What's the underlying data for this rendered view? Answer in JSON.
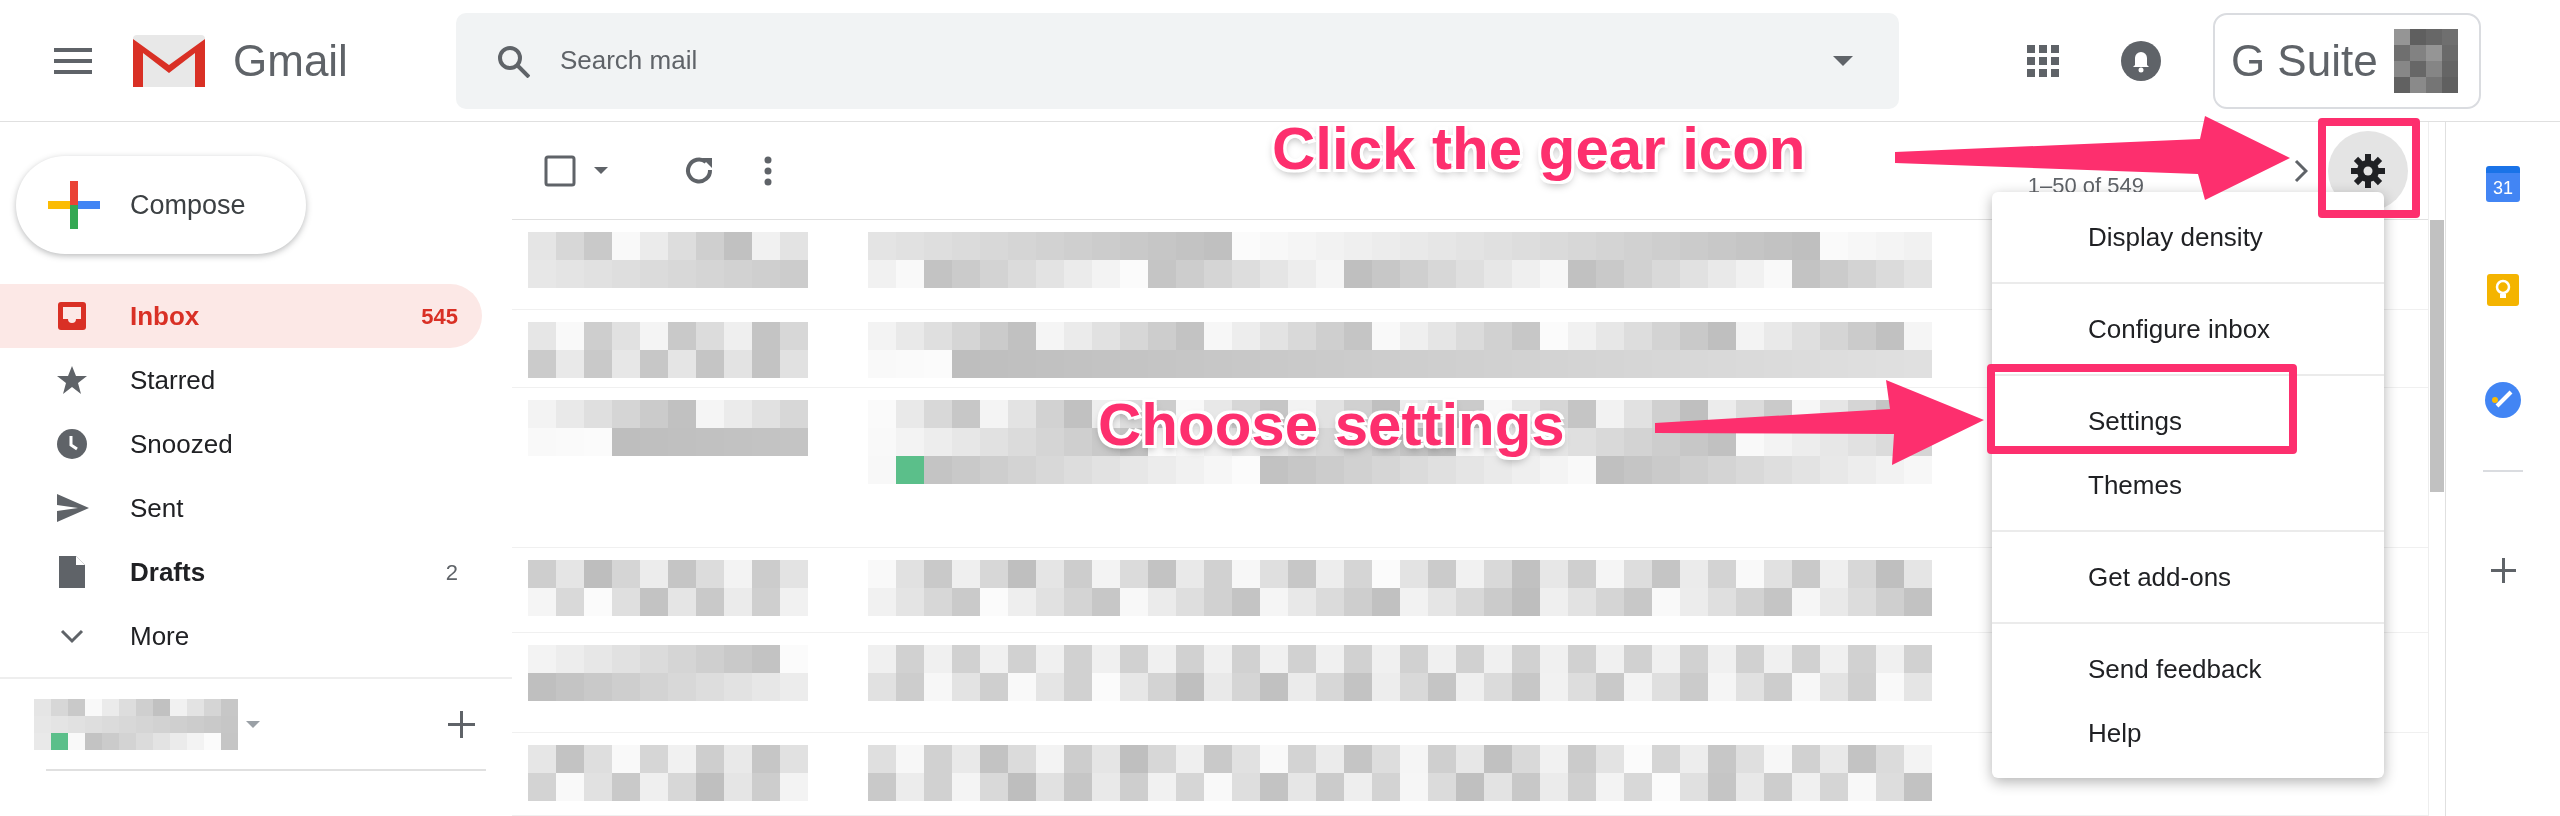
{
  "header": {
    "title": "Gmail",
    "search": {
      "placeholder": "Search mail"
    },
    "brand": "G Suite"
  },
  "sidebar": {
    "compose": "Compose",
    "items": [
      {
        "label": "Inbox",
        "count": "545",
        "selected": true,
        "unread": true
      },
      {
        "label": "Starred",
        "selected": false,
        "unread": false
      },
      {
        "label": "Snoozed",
        "selected": false,
        "unread": false
      },
      {
        "label": "Sent",
        "selected": false,
        "unread": false
      },
      {
        "label": "Drafts",
        "count": "2",
        "selected": false,
        "unread": true
      },
      {
        "label": "More",
        "selected": false,
        "unread": false
      }
    ]
  },
  "toolbar": {
    "pagination": "1–50 of 549",
    "settings_highlighted": true
  },
  "settings_menu": {
    "groups": [
      [
        {
          "label": "Display density",
          "highlighted": false
        }
      ],
      [
        {
          "label": "Configure inbox",
          "highlighted": false
        }
      ],
      [
        {
          "label": "Settings",
          "highlighted": true
        },
        {
          "label": "Themes",
          "highlighted": false
        }
      ],
      [
        {
          "label": "Get add-ons",
          "highlighted": false
        }
      ],
      [
        {
          "label": "Send feedback",
          "highlighted": false
        },
        {
          "label": "Help",
          "highlighted": false
        }
      ]
    ]
  },
  "side_panel": {
    "calendar_day": "31"
  },
  "annotations": [
    {
      "text": "Click the gear icon"
    },
    {
      "text": "Choose settings"
    }
  ]
}
